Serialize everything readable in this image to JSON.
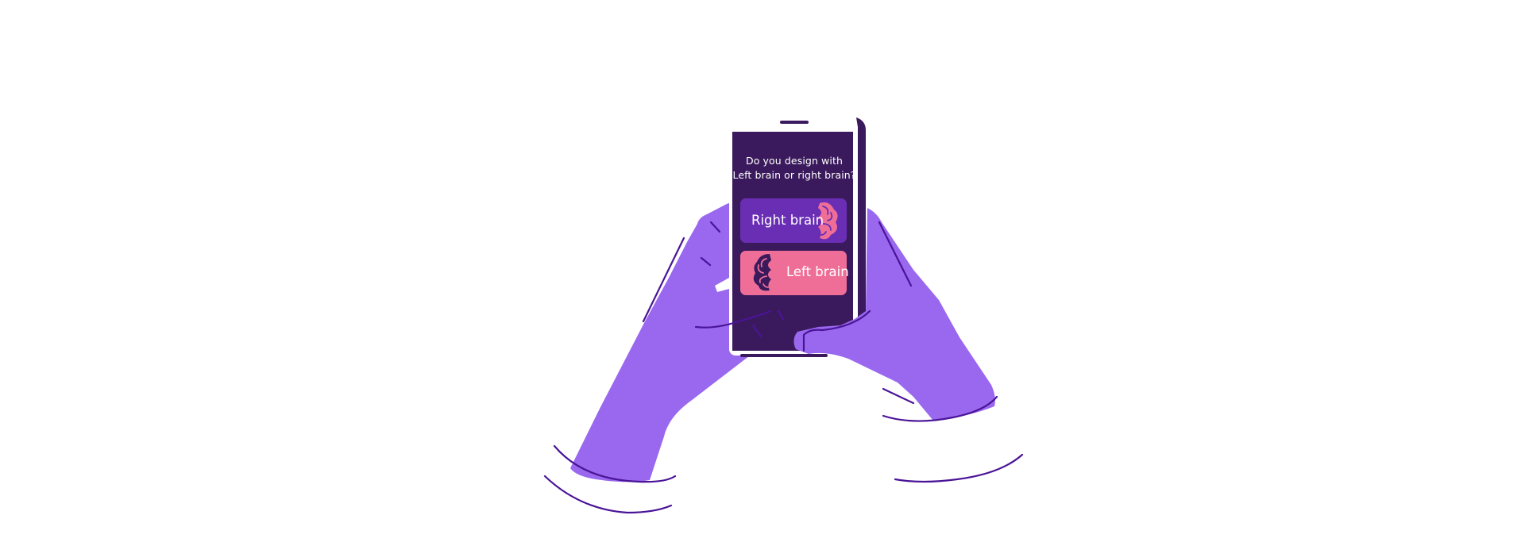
{
  "screen": {
    "question_line1": "Do you design with",
    "question_line2": "Left brain or right brain?"
  },
  "options": [
    {
      "label": "Right brain",
      "color": "#6a2eb5"
    },
    {
      "label": "Left brain",
      "color": "#ef6e98"
    }
  ],
  "icons": {
    "right_option": "brain-icon",
    "left_option": "brain-icon"
  },
  "colors": {
    "hand": "#9968ee",
    "outline": "#4a1497",
    "phone_screen": "#3a1a5c",
    "right_button": "#6a2eb5",
    "left_button": "#ef6e98",
    "right_brain_icon": "#ef6e98",
    "left_brain_icon": "#3a1a5c"
  }
}
